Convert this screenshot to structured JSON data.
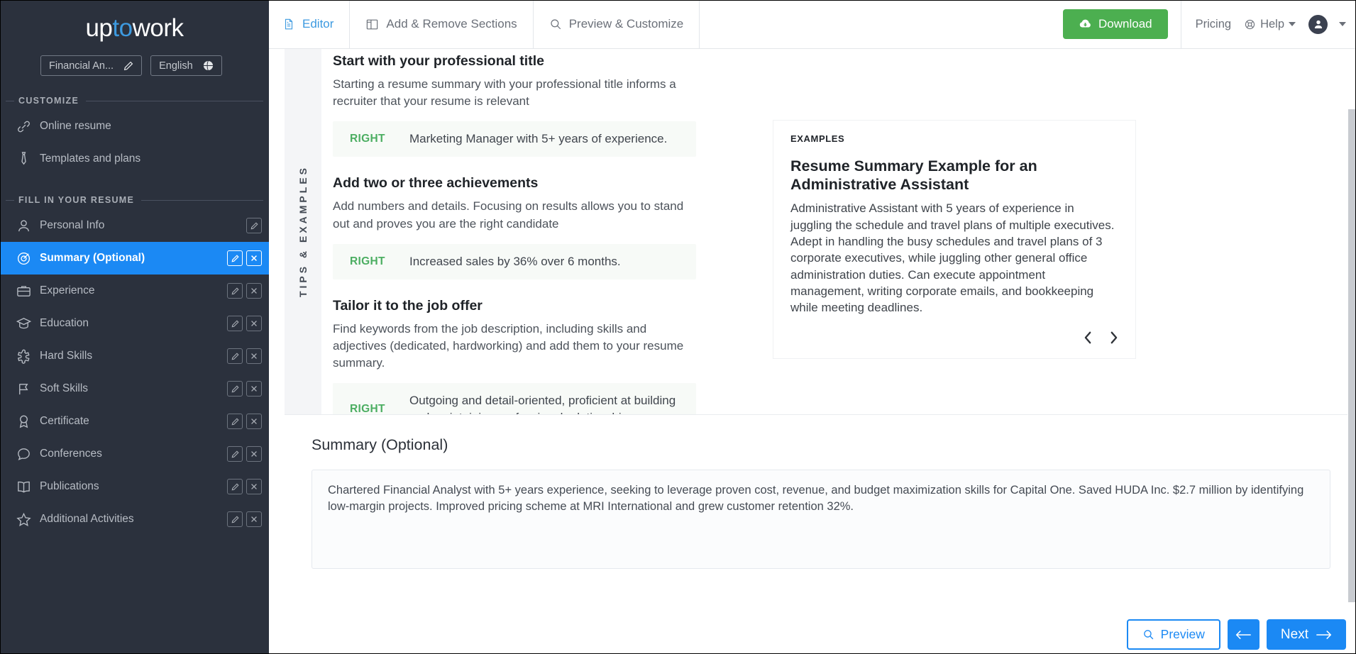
{
  "sidebar": {
    "brand": {
      "part1": "up",
      "accent": "to",
      "part2": "work"
    },
    "chips": [
      {
        "label": "Financial An...",
        "icon": "pencil-icon"
      },
      {
        "label": "English",
        "icon": "globe-icon"
      }
    ],
    "groups": [
      {
        "title": "CUSTOMIZE",
        "items": [
          {
            "label": "Online resume",
            "icon": "link-icon",
            "actions": []
          },
          {
            "label": "Templates and plans",
            "icon": "tie-icon",
            "actions": []
          }
        ]
      },
      {
        "title": "FILL IN YOUR RESUME",
        "items": [
          {
            "label": "Personal Info",
            "icon": "user-icon",
            "actions": [
              "edit"
            ]
          },
          {
            "label": "Summary (Optional)",
            "icon": "target-icon",
            "actions": [
              "edit",
              "close"
            ],
            "active": true
          },
          {
            "label": "Experience",
            "icon": "briefcase-icon",
            "actions": [
              "edit",
              "close"
            ]
          },
          {
            "label": "Education",
            "icon": "graduation-cap-icon",
            "actions": [
              "edit",
              "close"
            ]
          },
          {
            "label": "Hard Skills",
            "icon": "puzzle-icon",
            "actions": [
              "edit",
              "close"
            ]
          },
          {
            "label": "Soft Skills",
            "icon": "flag-icon",
            "actions": [
              "edit",
              "close"
            ]
          },
          {
            "label": "Certificate",
            "icon": "ribbon-icon",
            "actions": [
              "edit",
              "close"
            ]
          },
          {
            "label": "Conferences",
            "icon": "speech-bubble-icon",
            "actions": [
              "edit",
              "close"
            ]
          },
          {
            "label": "Publications",
            "icon": "book-icon",
            "actions": [
              "edit",
              "close"
            ]
          },
          {
            "label": "Additional Activities",
            "icon": "star-icon",
            "actions": [
              "edit",
              "close"
            ]
          }
        ]
      }
    ]
  },
  "topbar": {
    "tabs": [
      {
        "label": "Editor",
        "icon": "document-icon",
        "active": true
      },
      {
        "label": "Add & Remove Sections",
        "icon": "layout-icon",
        "active": false
      },
      {
        "label": "Preview & Customize",
        "icon": "search-icon",
        "active": false
      }
    ],
    "download_label": "Download",
    "download_icon": "cloud-download-icon",
    "download_color": "#4caf50",
    "pricing_label": "Pricing",
    "help_label": "Help",
    "help_icon": "lifebuoy-icon",
    "avatar_icon": "user-avatar-icon"
  },
  "tips": {
    "vertical_label": "TIPS & EXAMPLES",
    "blocks": [
      {
        "heading": "Start with your professional title",
        "paragraph": "Starting a resume summary with your professional title informs a recruiter that your resume is relevant",
        "tag": "RIGHT",
        "example": "Marketing Manager with 5+ years of experience."
      },
      {
        "heading": "Add two or three achievements",
        "paragraph": "Add numbers and details. Focusing on results allows you to stand out and proves you are the right candidate",
        "tag": "RIGHT",
        "example": "Increased sales by 36% over 6 months."
      },
      {
        "heading": "Tailor it to the job offer",
        "paragraph": "Find keywords from the job description, including skills and adjectives (dedicated, hardworking) and add them to your resume summary.",
        "tag": "RIGHT",
        "example": "Outgoing and detail-oriented, proficient at building and maintaining professional relationships."
      }
    ]
  },
  "examples": {
    "kicker": "EXAMPLES",
    "title": "Resume Summary Example for an Administrative Assistant",
    "body": "Administrative Assistant with 5 years of experience in juggling the schedule and travel plans of multiple executives. Adept in handling the busy schedules and travel plans of 3 corporate executives, while juggling other general office administration duties. Can execute appointment management, writing corporate emails, and bookkeeping while meeting deadlines.",
    "prev_icon": "chevron-left-icon",
    "next_icon": "chevron-right-icon"
  },
  "summary_section": {
    "heading": "Summary (Optional)",
    "value": "Chartered Financial Analyst with 5+ years experience, seeking to leverage proven cost, revenue, and budget maximization skills for Capital One. Saved HUDA Inc. $2.7 million by identifying low-margin projects. Improved pricing scheme at MRI International and grew customer retention 32%."
  },
  "actions": {
    "preview_label": "Preview",
    "preview_icon": "search-icon",
    "back_icon": "arrow-left-icon",
    "next_label": "Next",
    "next_icon": "arrow-right-icon",
    "accent_color": "#1b89f4"
  }
}
